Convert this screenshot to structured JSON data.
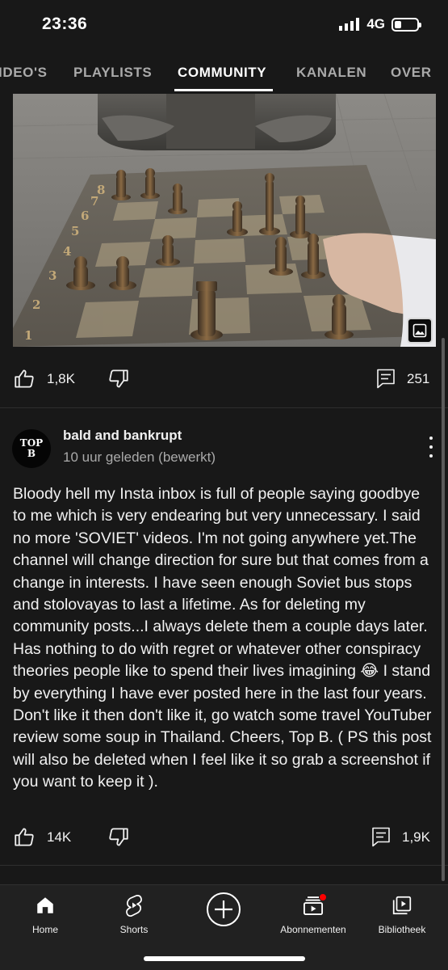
{
  "status_bar": {
    "time": "23:36",
    "network": "4G"
  },
  "tabs": [
    {
      "label": "IDEO'S",
      "active": false
    },
    {
      "label": "PLAYLISTS",
      "active": false
    },
    {
      "label": "COMMUNITY",
      "active": true
    },
    {
      "label": "KANALEN",
      "active": false
    },
    {
      "label": "OVER",
      "active": false
    }
  ],
  "photo": {
    "icon": "image-icon",
    "board_numbers": [
      "1",
      "2",
      "3",
      "4",
      "5",
      "6",
      "7",
      "8"
    ]
  },
  "post1": {
    "likes": "1,8K",
    "comments": "251"
  },
  "post2": {
    "avatar_text_1": "TOP",
    "avatar_text_2": "B",
    "author": "bald and bankrupt",
    "time": "10 uur geleden (bewerkt)",
    "text_before_emoji": "Bloody hell my Insta inbox is full of people saying goodbye to me which is very endearing but very unnecessary. I said no more 'SOVIET' videos. I'm not going anywhere yet.The channel will change direction for sure but that comes from a change in interests. I have seen enough Soviet bus stops and stolovayas to last a lifetime. As for deleting my community posts...I always delete them a couple days later. Has nothing to do with regret or whatever other conspiracy theories people like to spend their lives imagining",
    "emoji": "😂",
    "text_after_emoji": "I stand by everything I have ever posted here in the last four years. Don't like it then don't like it, go watch some travel YouTuber review some soup in Thailand. Cheers, Top B. ( PS this post will also be deleted when I feel like it so grab a screenshot if you want to keep it ).",
    "likes": "14K",
    "comments": "1,9K"
  },
  "bottom_nav": [
    {
      "label": "Home",
      "icon": "home-icon"
    },
    {
      "label": "Shorts",
      "icon": "shorts-icon"
    },
    {
      "label": "",
      "icon": "create-icon"
    },
    {
      "label": "Abonnementen",
      "icon": "subscriptions-icon"
    },
    {
      "label": "Bibliotheek",
      "icon": "library-icon"
    }
  ],
  "colors": {
    "background": "#181818",
    "text": "#f1f1f1",
    "muted": "#aaaaaa",
    "notification": "#ff0000"
  }
}
